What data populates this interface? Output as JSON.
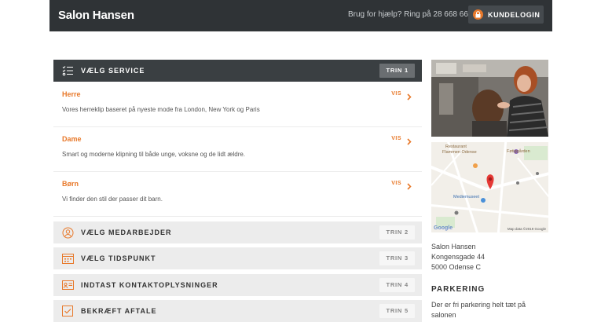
{
  "header": {
    "brand": "Salon Hansen",
    "help_text": "Brug for hjælp? Ring på 28 668 668",
    "login_label": "KUNDELOGIN"
  },
  "step1": {
    "title": "VÆLG SERVICE",
    "badge": "TRIN 1"
  },
  "services": [
    {
      "name": "Herre",
      "desc": "Vores herreklip baseret på nyeste mode fra London, New York og Paris",
      "action": "VIS"
    },
    {
      "name": "Dame",
      "desc": "Smart og moderne klipning til både unge, voksne og de lidt ældre.",
      "action": "VIS"
    },
    {
      "name": "Børn",
      "desc": "Vi finder den stil der passer dit barn.",
      "action": "VIS"
    }
  ],
  "steps": [
    {
      "title": "VÆLG MEDARBEJDER",
      "badge": "TRIN 2",
      "icon": "person-icon"
    },
    {
      "title": "VÆLG TIDSPUNKT",
      "badge": "TRIN 3",
      "icon": "calendar-icon"
    },
    {
      "title": "INDTAST KONTAKTOPLYSNINGER",
      "badge": "TRIN 4",
      "icon": "id-card-icon"
    },
    {
      "title": "BEKRÆFT AFTALE",
      "badge": "TRIN 5",
      "icon": "check-icon"
    }
  ],
  "map": {
    "labels": [
      "Restaurant",
      "Flammen Odense",
      "Føtiggården",
      "Mediemuseet"
    ],
    "google": "Google",
    "copyright": "Map data ©2019 Google"
  },
  "address": {
    "line1": "Salon Hansen",
    "line2": "Kongensgade 44",
    "line3": "5000 Odense C"
  },
  "parking": {
    "title": "PARKERING",
    "text": "Der er fri parkering helt tæt på salonen"
  },
  "colors": {
    "accent": "#e8792b",
    "dark": "#2f3336",
    "step_active": "#3a3f42"
  }
}
